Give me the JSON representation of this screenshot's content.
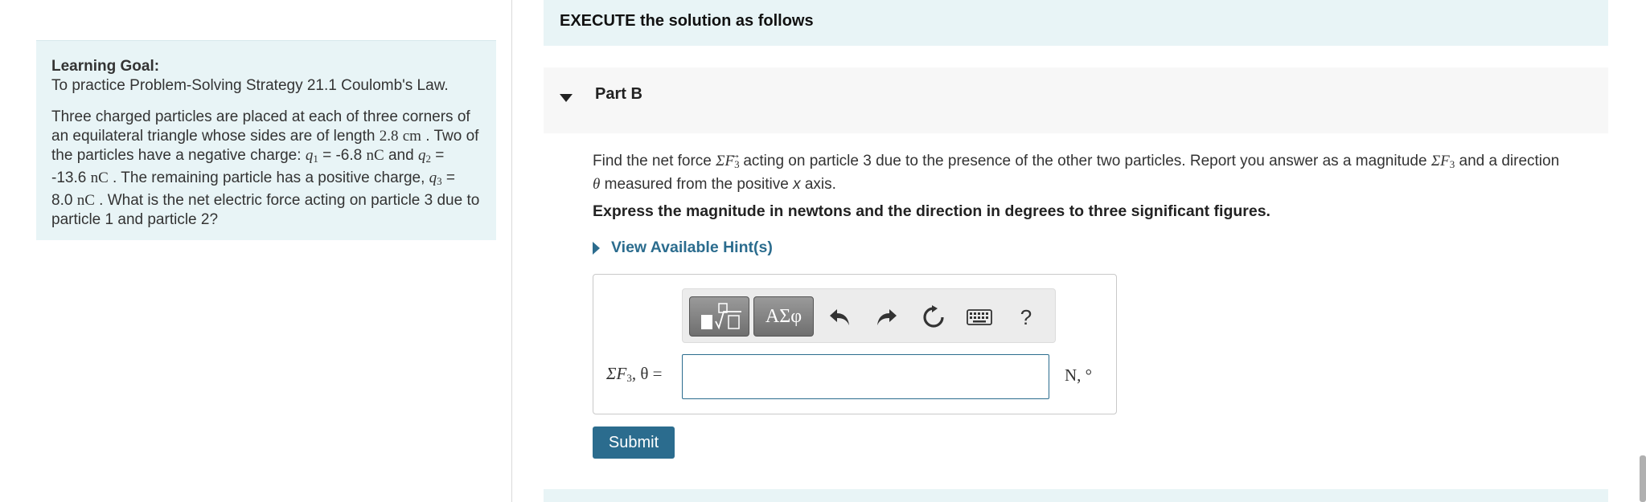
{
  "goal": {
    "title": "Learning Goal:",
    "subtitle": "To practice Problem-Solving Strategy 21.1 Coulomb's Law.",
    "p1": "Three charged particles are placed at each of three corners of an equilateral triangle whose sides are of length",
    "side_length": "2.8",
    "side_unit": "cm",
    "p2": "Two of the particles have a negative charge:",
    "q1_symbol": "q",
    "q1_sub": "1",
    "q1_value": "-6.8",
    "charge_unit": "nC",
    "and_word": "and",
    "q2_symbol": "q",
    "q2_sub": "2",
    "q2_value": "-13.6",
    "p3": "The remaining particle has a positive charge,",
    "q3_symbol": "q",
    "q3_sub": "3",
    "q3_value": "8.0",
    "p4": "What is the net electric force acting on particle 3 due to particle 1 and particle 2?"
  },
  "execute_banner": "EXECUTE the solution as follows",
  "part": {
    "title": "Part B",
    "question_a": "Find the net force",
    "force_symbol": "ΣF",
    "force_sub": "3",
    "question_b": "acting on particle 3 due to the presence of the other two particles. Report you answer as a magnitude",
    "question_c": "and a direction",
    "theta": "θ",
    "question_d": "measured from the positive",
    "x_axis": "x",
    "question_e": "axis.",
    "instruction": "Express the magnitude in newtons and the direction in degrees to three significant figures.",
    "hint_label": "View Available Hint(s)"
  },
  "toolbar": {
    "templates_icon": "sqrt-template-icon",
    "symbols_label": "ΑΣφ",
    "undo_icon": "undo-icon",
    "redo_icon": "redo-icon",
    "reset_icon": "reset-icon",
    "keyboard_icon": "keyboard-icon",
    "help_label": "?"
  },
  "answer": {
    "label_sigma": "ΣF",
    "label_sub": "3",
    "label_rest": ", θ =",
    "value": "",
    "units": "N, °"
  },
  "submit_label": "Submit",
  "colors": {
    "panel_bg": "#e8f4f6",
    "link": "#2b6c8e",
    "button": "#2b6c8e"
  }
}
